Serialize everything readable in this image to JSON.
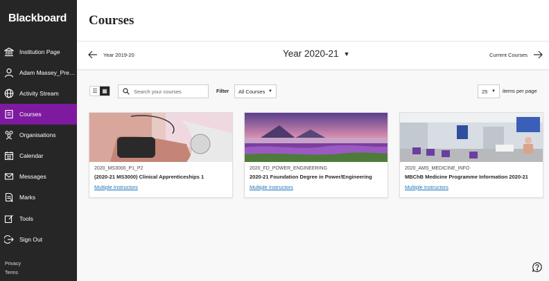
{
  "brand": {
    "logo_text": "Blackboard",
    "accent": "#7d1aa0"
  },
  "sidebar": {
    "items": [
      {
        "label": "Institution Page",
        "icon": "institution-icon"
      },
      {
        "label": "Adam Massey_Previ...",
        "icon": "user-icon"
      },
      {
        "label": "Activity Stream",
        "icon": "globe-icon"
      },
      {
        "label": "Courses",
        "icon": "courses-icon",
        "active": true
      },
      {
        "label": "Organisations",
        "icon": "organisations-icon"
      },
      {
        "label": "Calendar",
        "icon": "calendar-icon"
      },
      {
        "label": "Messages",
        "icon": "envelope-icon"
      },
      {
        "label": "Marks",
        "icon": "marks-icon"
      },
      {
        "label": "Tools",
        "icon": "tools-icon"
      },
      {
        "label": "Sign Out",
        "icon": "sign-out-icon"
      }
    ],
    "footer": {
      "privacy": "Privacy",
      "terms": "Terms"
    }
  },
  "header": {
    "title": "Courses"
  },
  "year_nav": {
    "prev_label": "Year 2019-20",
    "current_label": "Year 2020-21",
    "next_label": "Current Courses"
  },
  "toolbar": {
    "search_placeholder": "Search your courses",
    "filter_label": "Filter",
    "filter_value": "All Courses",
    "per_page_value": "25",
    "per_page_label": "items per page"
  },
  "courses": [
    {
      "id": "2020_MS3000_P1_P2",
      "name": "(2020-21 MS3000) Clinical Apprenticeships 1",
      "instructors": "Multiple Instructors"
    },
    {
      "id": "2020_FD_POWER_ENGINEERING",
      "name": "2020-21 Foundation Degree in Power/Engineering",
      "instructors": "Multiple Instructors"
    },
    {
      "id": "2020_AMS_MEDICINE_INFO",
      "name": "MBChB Medicine Programme Information 2020-21",
      "instructors": "Multiple Instructors"
    }
  ]
}
